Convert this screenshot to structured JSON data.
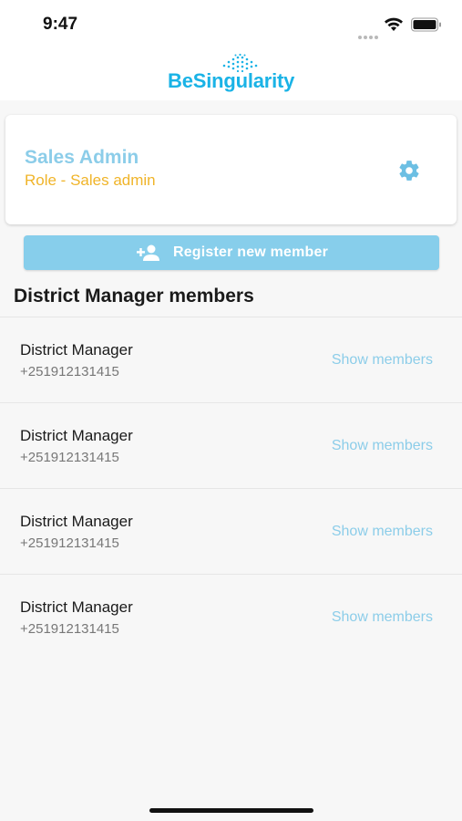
{
  "status_bar": {
    "time": "9:47"
  },
  "header": {
    "logo_text": "BeSingularity",
    "logo_color": "#1ab3e6"
  },
  "profile": {
    "name": "Sales Admin",
    "role": "Role - Sales admin",
    "settings_icon": "gear-icon"
  },
  "register": {
    "label": "Register new member",
    "icon": "add-person-icon"
  },
  "section": {
    "title": "District Manager members"
  },
  "members": [
    {
      "name": "District Manager",
      "phone": "+251912131415",
      "action": "Show members"
    },
    {
      "name": "District Manager",
      "phone": "+251912131415",
      "action": "Show members"
    },
    {
      "name": "District Manager",
      "phone": "+251912131415",
      "action": "Show members"
    },
    {
      "name": "District Manager",
      "phone": "+251912131415",
      "action": "Show members"
    }
  ],
  "colors": {
    "accent": "#87ceeb",
    "name_blue": "#8ccde9",
    "role_yellow": "#f0b429"
  }
}
